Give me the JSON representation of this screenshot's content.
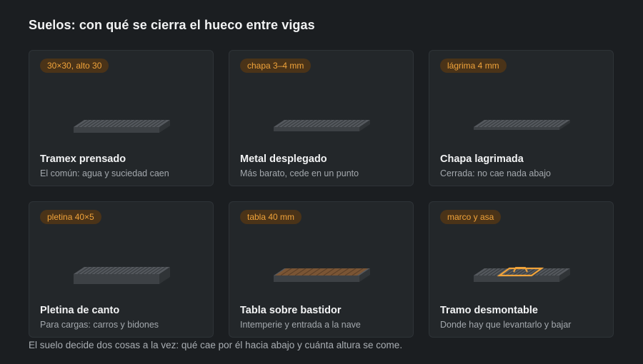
{
  "page": {
    "title": "Suelos: con qué se cierra el hueco entre vigas",
    "footer": "El suelo decide dos cosas a la vez: qué cae por él hacia abajo y cuánta altura se come."
  },
  "colors": {
    "background": "#1b1e21",
    "card": "#23272a",
    "accent": "#f0a33a",
    "badge_bg": "#4a3318"
  },
  "cards": [
    {
      "badge": "30×30, alto 30",
      "title": "Tramex prensado",
      "subtitle": "El común: agua y suciedad caen",
      "icon": "pressed-grating-icon"
    },
    {
      "badge": "chapa 3–4 mm",
      "title": "Metal desplegado",
      "subtitle": "Más barato, cede en un punto",
      "icon": "expanded-metal-icon"
    },
    {
      "badge": "lágrima 4 mm",
      "title": "Chapa lagrimada",
      "subtitle": "Cerrada: no cae nada abajo",
      "icon": "tread-plate-icon"
    },
    {
      "badge": "pletina 40×5",
      "title": "Pletina de canto",
      "subtitle": "Para cargas: carros y bidones",
      "icon": "bar-grating-icon"
    },
    {
      "badge": "tabla 40 mm",
      "title": "Tabla sobre bastidor",
      "subtitle": "Intemperie y entrada a la nave",
      "icon": "timber-deck-icon"
    },
    {
      "badge": "marco y asa",
      "title": "Tramo desmontable",
      "subtitle": "Donde hay que levantarlo y bajar",
      "icon": "removable-panel-icon"
    }
  ]
}
